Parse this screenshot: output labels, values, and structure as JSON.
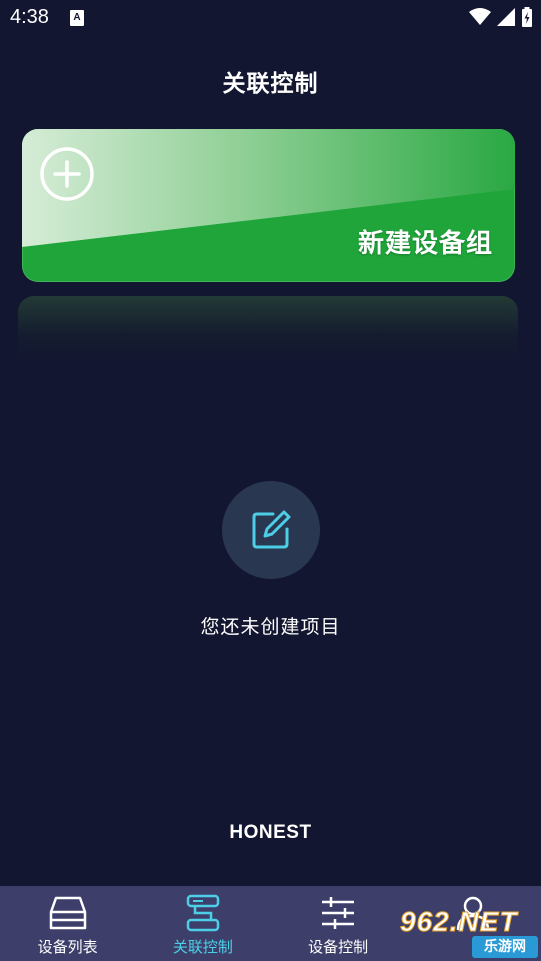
{
  "status_bar": {
    "time": "4:38",
    "notification_letter": "A",
    "icons": [
      "wifi-icon",
      "signal-icon",
      "battery-icon"
    ]
  },
  "header": {
    "title": "关联控制"
  },
  "new_group_card": {
    "label": "新建设备组",
    "icon": "plus-circle-icon",
    "color": "#1fa53a"
  },
  "empty_state": {
    "icon": "edit-icon",
    "message": "您还未创建项目"
  },
  "brand": {
    "logo_text": "HONEST"
  },
  "bottom_nav": {
    "items": [
      {
        "label": "设备列表",
        "icon": "device-list-icon",
        "active": false
      },
      {
        "label": "关联控制",
        "icon": "link-control-icon",
        "active": true
      },
      {
        "label": "设备控制",
        "icon": "sliders-icon",
        "active": false
      },
      {
        "label": "",
        "icon": "user-icon",
        "active": false
      }
    ],
    "active_color": "#4ccfe6"
  },
  "watermark": {
    "top_text": "962.NET",
    "bottom_text": "乐游网"
  }
}
